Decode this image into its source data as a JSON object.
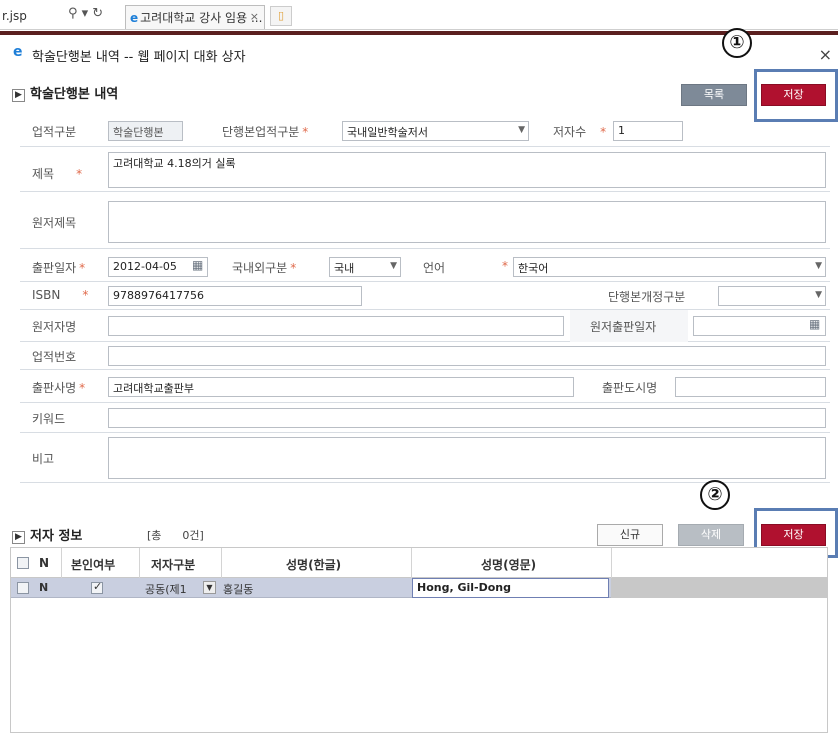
{
  "browser": {
    "url_suffix": "r.jsp",
    "tab_title": "고려대학교 강사 임용 ...",
    "tab_close": "×"
  },
  "dialog": {
    "title": "학술단행본 내역 -- 웹 페이지 대화 상자",
    "close": "×"
  },
  "section1": {
    "title": "학술단행본 내역",
    "list_button": "목록",
    "save_button": "저장",
    "marker": "①"
  },
  "form": {
    "work_type_label": "업적구분",
    "work_type_value": "학술단행본",
    "book_type_label": "단행본업적구분",
    "book_type_value": "국내일반학술저서",
    "author_count_label": "저자수",
    "author_count_value": "1",
    "title_label": "제목",
    "title_value": "고려대학교 4.18의거 실록",
    "orig_title_label": "원저제목",
    "orig_title_value": "",
    "pub_date_label": "출판일자",
    "pub_date_value": "2012-04-05",
    "domestic_label": "국내외구분",
    "domestic_value": "국내",
    "language_label": "언어",
    "language_value": "한국어",
    "isbn_label": "ISBN",
    "isbn_value": "9788976417756",
    "revision_label": "단행본개정구분",
    "revision_value": "",
    "orig_author_label": "원저자명",
    "orig_author_value": "",
    "orig_pub_date_label": "원저출판일자",
    "orig_pub_date_value": "",
    "work_no_label": "업적번호",
    "work_no_value": "",
    "publisher_label": "출판사명",
    "publisher_value": "고려대학교출판부",
    "pub_city_label": "출판도시명",
    "pub_city_value": "",
    "keyword_label": "키워드",
    "keyword_value": "",
    "note_label": "비고",
    "note_value": ""
  },
  "section2": {
    "title": "저자 정보",
    "count_text": "[총      0건]",
    "new_button": "신규",
    "delete_button": "삭제",
    "save_button": "저장",
    "marker": "②"
  },
  "grid": {
    "headers": [
      "N",
      "본인여부",
      "저자구분",
      "성명(한글)",
      "성명(영문)"
    ],
    "rows": [
      {
        "n": "N",
        "self": true,
        "author_type": "공동(제1",
        "name_ko": "홍길동",
        "name_en": "Hong, Gil-Dong"
      }
    ]
  }
}
